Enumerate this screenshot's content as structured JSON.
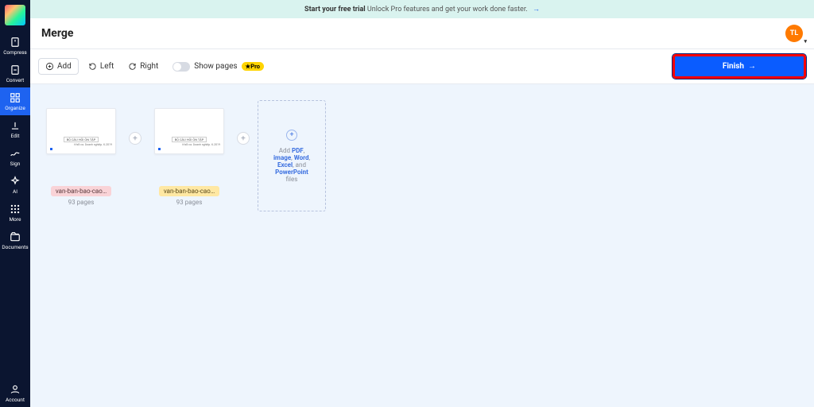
{
  "banner": {
    "bold": "Start your free trial",
    "rest": "Unlock Pro features and get your work done faster."
  },
  "title": "Merge",
  "avatar": "TL",
  "toolbar": {
    "add": "Add",
    "left": "Left",
    "right": "Right",
    "show_pages": "Show pages",
    "pro": "★Pro",
    "finish": "Finish"
  },
  "sidebar": {
    "compress": "Compress",
    "convert": "Convert",
    "organize": "Organize",
    "edit": "Edit",
    "sign": "Sign",
    "ai": "AI",
    "more": "More",
    "documents": "Documents",
    "account": "Account"
  },
  "docs": [
    {
      "name": "van-ban-bao-cao…",
      "pages": "93 pages",
      "t1": "BỘ CÂU HỎI ÔN TẬP",
      "t2": "Khối ca. Doanh nghiệp. K.2019"
    },
    {
      "name": "van-ban-bao-cao…",
      "pages": "93 pages",
      "t1": "BỘ CÂU HỎI ÔN TẬP",
      "t2": "Khối ca. Doanh nghiệp. K.2019"
    }
  ],
  "dropzone": {
    "add": "Add ",
    "pdf": "PDF",
    "c1": ", ",
    "image": "image",
    "c2": ", ",
    "word": "Word",
    "c3": ", ",
    "excel": "Excel",
    "and": ", and ",
    "ppt": "PowerPoint",
    "files": "files"
  }
}
